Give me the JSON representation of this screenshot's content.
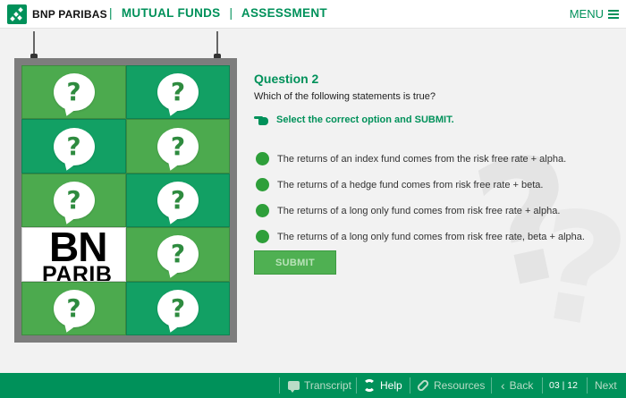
{
  "header": {
    "brand": "BNP PARIBAS",
    "crumbs": [
      "MUTUAL FUNDS",
      "ASSESSMENT"
    ],
    "menu_label": "MENU"
  },
  "board": {
    "tile_glyph": "?",
    "logo_tile": {
      "line1": "BN",
      "line2": "PARIB"
    }
  },
  "question": {
    "title": "Question 2",
    "text": "Which of the following statements is true?",
    "instruction": "Select the correct option and SUBMIT.",
    "options": [
      "The returns of an index fund comes from the risk free rate + alpha.",
      "The returns of a hedge fund comes from risk free rate + beta.",
      "The returns of a long only fund comes from risk free rate + alpha.",
      "The returns of a long only fund comes from risk free rate, beta + alpha."
    ],
    "submit_label": "SUBMIT"
  },
  "footer": {
    "transcript": "Transcript",
    "help": "Help",
    "resources": "Resources",
    "back": "Back",
    "page": "03 | 12",
    "next": "Next"
  },
  "colors": {
    "brand_green": "#00915a",
    "tile_light": "#4caa4e",
    "tile_dark": "#12a064"
  }
}
